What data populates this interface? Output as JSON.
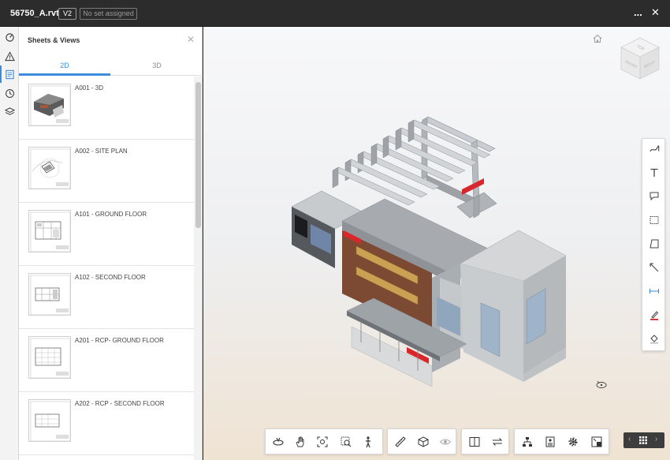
{
  "header": {
    "file_title": "56750_A.rvt",
    "version": "V2",
    "set_status": "No set assigned",
    "more_label": "...",
    "close_label": "✕"
  },
  "left_rail": {
    "icons": [
      "progress-icon",
      "warning-icon",
      "sheets-icon",
      "history-icon",
      "layers-icon"
    ],
    "active": "sheets-icon"
  },
  "panel": {
    "title": "Sheets & Views",
    "close_label": "✕",
    "tabs": [
      {
        "label": "2D",
        "active": true
      },
      {
        "label": "3D",
        "active": false
      }
    ],
    "sheets": [
      {
        "label": "A001 - 3D"
      },
      {
        "label": "A002 - SITE PLAN"
      },
      {
        "label": "A101 - GROUND FLOOR"
      },
      {
        "label": "A102 - SECOND FLOOR"
      },
      {
        "label": "A201 - RCP- GROUND FLOOR"
      },
      {
        "label": "A202 - RCP - SECOND FLOOR"
      }
    ]
  },
  "viewcube": {
    "top": "TOP",
    "front": "FRONT",
    "right": "RIGHT"
  },
  "colors": {
    "accent": "#3e8ddd",
    "topbar": "#2c2c2c",
    "markup_red": "#d9262c"
  }
}
